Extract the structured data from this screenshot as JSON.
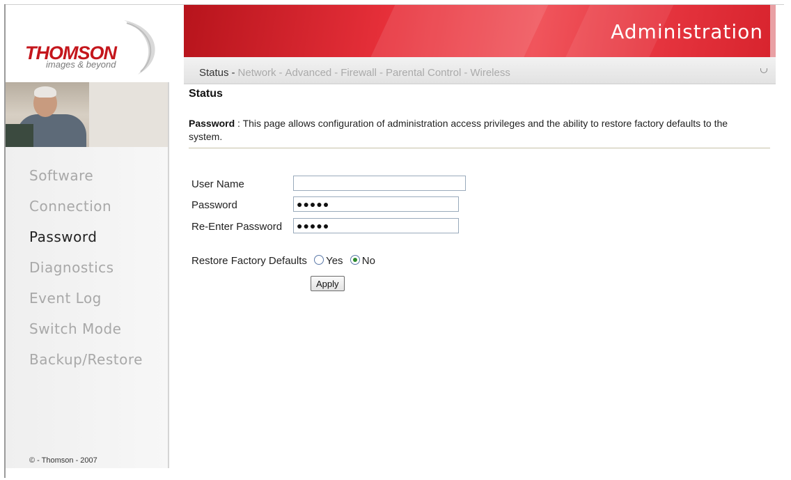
{
  "brand": {
    "logo_text": "THOMSON",
    "tagline": "images & beyond",
    "banner_title": "Administration"
  },
  "top_nav": {
    "items": [
      {
        "label": "Status",
        "active": true
      },
      {
        "label": "Network",
        "active": false
      },
      {
        "label": "Advanced",
        "active": false
      },
      {
        "label": "Firewall",
        "active": false
      },
      {
        "label": "Parental Control",
        "active": false
      },
      {
        "label": "Wireless",
        "active": false
      }
    ],
    "separator": "-"
  },
  "sidebar": {
    "items": [
      {
        "label": "Software",
        "active": false
      },
      {
        "label": "Connection",
        "active": false
      },
      {
        "label": "Password",
        "active": true
      },
      {
        "label": "Diagnostics",
        "active": false
      },
      {
        "label": "Event Log",
        "active": false
      },
      {
        "label": "Switch Mode",
        "active": false
      },
      {
        "label": "Backup/Restore",
        "active": false
      }
    ],
    "copyright": "© - Thomson - 2007"
  },
  "main": {
    "heading": "Status",
    "description_title": "Password",
    "description_sep": " : ",
    "description_text": " This page allows configuration of administration access privileges and the ability to restore factory defaults to the system."
  },
  "form": {
    "username_label": "User Name",
    "username_value": "",
    "password_label": "Password",
    "password_value": "●●●●●",
    "reenter_label": "Re-Enter Password",
    "reenter_value": "●●●●●",
    "restore_label": "Restore Factory Defaults",
    "option_yes": "Yes",
    "option_no": "No",
    "selected_option": "No",
    "apply_label": "Apply"
  },
  "colors": {
    "accent_red": "#c4161c",
    "banner_red": "#e7303a",
    "inactive_text": "#aaaaaa"
  }
}
